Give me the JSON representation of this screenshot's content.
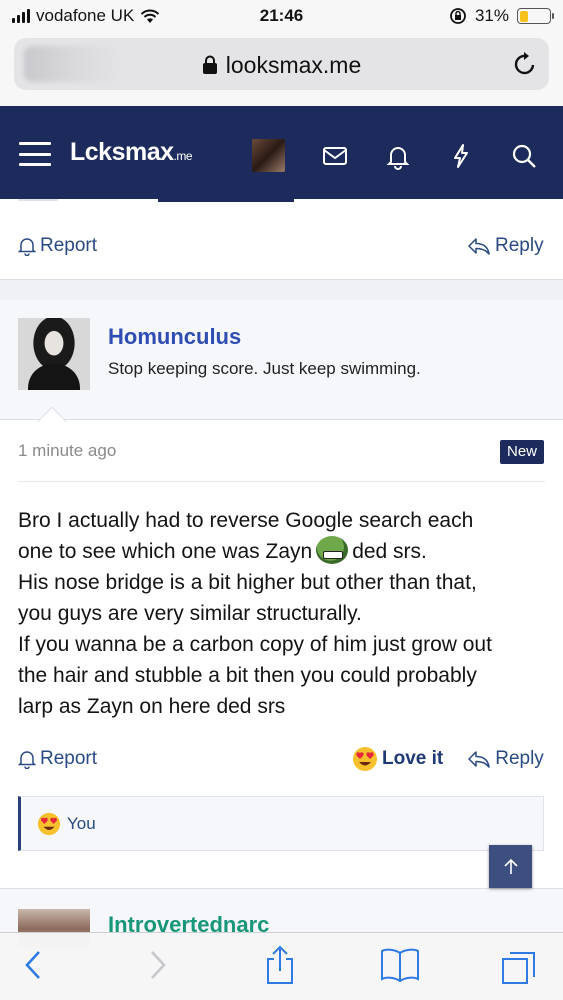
{
  "status_bar": {
    "carrier": "vodafone UK",
    "time": "21:46",
    "battery": "31%"
  },
  "browser": {
    "url": "looksmax.me"
  },
  "header": {
    "logo_main": "Lcksmax",
    "logo_suffix": ".me"
  },
  "prev_post": {
    "report_label": "Report",
    "reply_label": "Reply"
  },
  "post": {
    "username": "Homunculus",
    "user_title": "Stop keeping score. Just keep swimming.",
    "date": "1 minute ago",
    "badge": "New",
    "message": {
      "line1": "Bro I actually had to reverse Google search each",
      "line2_before": "one to see which one was Zayn",
      "line2_after": "ded srs.",
      "line3": "His nose bridge is a bit higher but other than that,",
      "line4": "you guys are very similar structurally.",
      "line5": "If you wanna be a carbon copy of him just grow out",
      "line6": "the hair and stubble a bit then you could probably",
      "line7": "larp as Zayn on here ded srs"
    },
    "actions": {
      "report_label": "Report",
      "love_label": "Love it",
      "reply_label": "Reply"
    },
    "reactions": {
      "users": "You"
    }
  },
  "next_post": {
    "username": "Introvertednarc"
  },
  "colors": {
    "header_bg": "#1c2b5b",
    "username": "#2f4db2",
    "username_alt": "#17967a",
    "link": "#2a4a82"
  }
}
